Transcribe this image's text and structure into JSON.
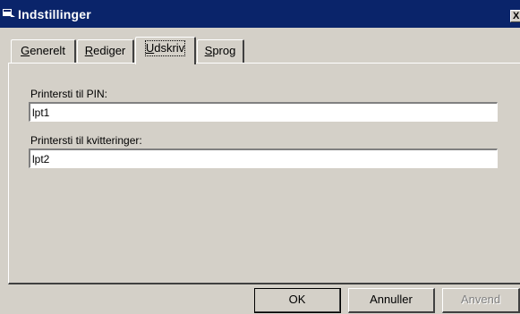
{
  "window": {
    "title": "Indstillinger",
    "close_label": "X"
  },
  "tabs": [
    {
      "label": "Generelt",
      "active": false
    },
    {
      "label": "Rediger",
      "active": false
    },
    {
      "label": "Udskriv",
      "active": true
    },
    {
      "label": "Sprog",
      "active": false
    }
  ],
  "fields": [
    {
      "label": "Printersti til PIN:",
      "value": "lpt1"
    },
    {
      "label": "Printersti til kvitteringer:",
      "value": "lpt2"
    }
  ],
  "buttons": {
    "ok": "OK",
    "cancel": "Annuller",
    "apply": "Anvend"
  }
}
